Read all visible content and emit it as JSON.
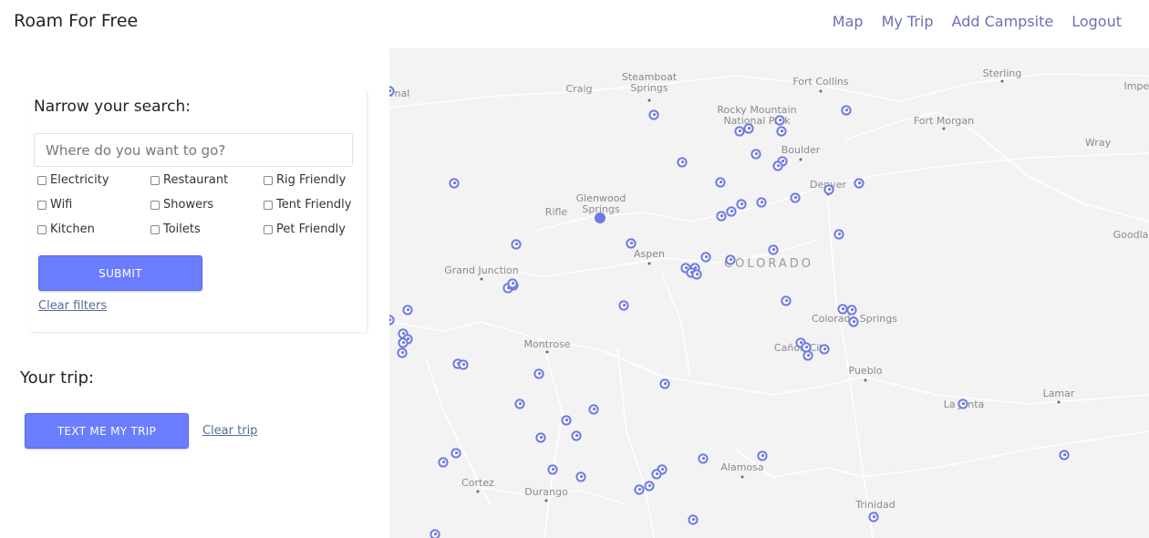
{
  "header": {
    "brand": "Roam For Free",
    "nav": {
      "map": "Map",
      "my_trip": "My Trip",
      "add_campsite": "Add Campsite",
      "logout": "Logout"
    }
  },
  "filters": {
    "title": "Narrow your search:",
    "search_placeholder": "Where do you want to go?",
    "options": {
      "electricity": "Electricity",
      "restaurant": "Restaurant",
      "rig_friendly": "Rig Friendly",
      "wifi": "Wifi",
      "showers": "Showers",
      "tent_friendly": "Tent Friendly",
      "kitchen": "Kitchen",
      "toilets": "Toilets",
      "pet_friendly": "Pet Friendly"
    },
    "submit_label": "SUBMIT",
    "clear_label": "Clear filters"
  },
  "trip": {
    "title": "Your trip:",
    "text_button": "TEXT ME MY TRIP",
    "clear_label": "Clear trip"
  },
  "map": {
    "state_label": "COLORADO",
    "cities": {
      "steamboat": "Steamboat\nSprings",
      "fort_collins": "Fort Collins",
      "sterling": "Sterling",
      "craig": "Craig",
      "rmnp": "Rocky Mountain\nNational Park",
      "fort_morgan": "Fort Morgan",
      "wray": "Wray",
      "boulder": "Boulder",
      "denver": "Denver",
      "glenwood": "Glenwood\nSprings",
      "rifle": "Rifle",
      "aspen": "Aspen",
      "grand_junction": "Grand Junction",
      "montrose": "Montrose",
      "canon_city": "Cañon City",
      "colorado_springs": "Colorado Springs",
      "pueblo": "Pueblo",
      "la_junta": "La Junta",
      "lamar": "Lamar",
      "alamosa": "Alamosa",
      "cortez": "Cortez",
      "durango": "Durango",
      "trinidad": "Trinidad",
      "goodland": "Goodland",
      "vernal": "Vernal",
      "imperial": "Imperial"
    },
    "marker_color": "#6f7ae0",
    "base_color": "#f3f3f3",
    "road_color": "#ffffff"
  }
}
